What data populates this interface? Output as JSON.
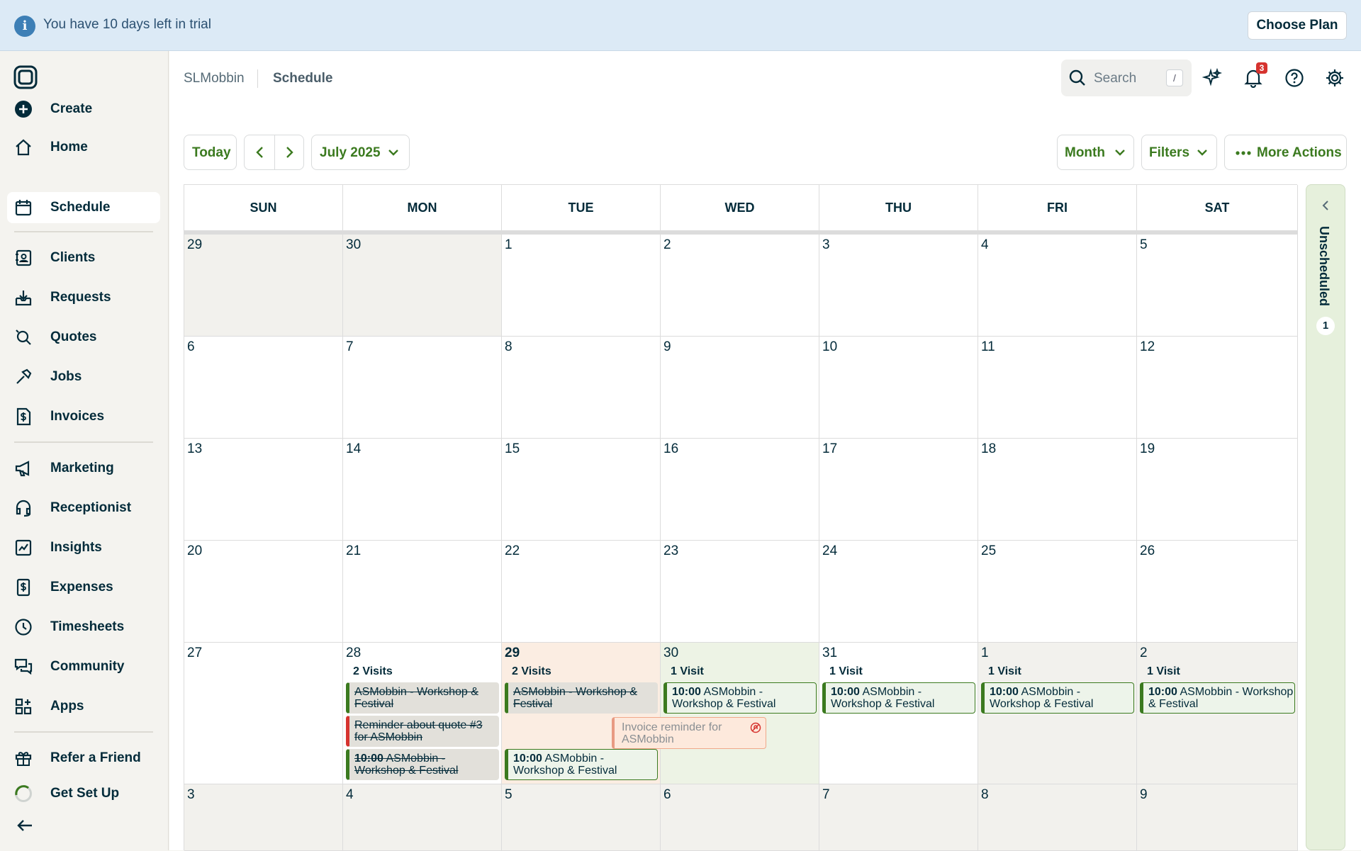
{
  "banner": {
    "message": "You have 10 days left in trial",
    "cta": "Choose Plan"
  },
  "nav": {
    "items": [
      {
        "label": "Create",
        "icon": "plus-circle-icon",
        "active": false
      },
      {
        "label": "Home",
        "icon": "home-icon",
        "active": false
      },
      {
        "label": "Schedule",
        "icon": "calendar-icon",
        "active": true
      },
      {
        "label": "Clients",
        "icon": "address-book-icon",
        "active": false
      },
      {
        "label": "Requests",
        "icon": "inbox-download-icon",
        "active": false
      },
      {
        "label": "Quotes",
        "icon": "quote-search-icon",
        "active": false
      },
      {
        "label": "Jobs",
        "icon": "hammer-icon",
        "active": false
      },
      {
        "label": "Invoices",
        "icon": "invoice-dollar-icon",
        "active": false
      },
      {
        "label": "Marketing",
        "icon": "megaphone-icon",
        "active": false
      },
      {
        "label": "Receptionist",
        "icon": "headset-icon",
        "active": false
      },
      {
        "label": "Insights",
        "icon": "chart-line-icon",
        "active": false
      },
      {
        "label": "Expenses",
        "icon": "receipt-dollar-icon",
        "active": false
      },
      {
        "label": "Timesheets",
        "icon": "clock-icon",
        "active": false
      },
      {
        "label": "Community",
        "icon": "chat-bubbles-icon",
        "active": false
      },
      {
        "label": "Apps",
        "icon": "apps-grid-icon",
        "active": false
      },
      {
        "label": "Refer a Friend",
        "icon": "gift-icon",
        "active": false
      },
      {
        "label": "Get Set Up",
        "icon": "progress-ring-icon",
        "active": false
      }
    ]
  },
  "header": {
    "account": "SLMobbin",
    "page": "Schedule",
    "search_placeholder": "Search",
    "search_shortcut": "/",
    "notifications": "3"
  },
  "toolbar": {
    "today": "Today",
    "month_label": "July 2025",
    "view": "Month",
    "filters": "Filters",
    "more": "More Actions"
  },
  "calendar": {
    "weekdays": [
      "SUN",
      "MON",
      "TUE",
      "WED",
      "THU",
      "FRI",
      "SAT"
    ],
    "weeks": [
      [
        "29",
        "30",
        "1",
        "2",
        "3",
        "4",
        "5"
      ],
      [
        "6",
        "7",
        "8",
        "9",
        "10",
        "11",
        "12"
      ],
      [
        "13",
        "14",
        "15",
        "16",
        "17",
        "18",
        "19"
      ],
      [
        "20",
        "21",
        "22",
        "23",
        "24",
        "25",
        "26"
      ],
      [
        "27",
        "28",
        "29",
        "30",
        "31",
        "1",
        "2"
      ],
      [
        "3",
        "4",
        "5",
        "6",
        "7",
        "8",
        "9"
      ]
    ],
    "visit_counts": {
      "mon": "2 Visits",
      "tue": "2 Visits",
      "wed": "1 Visit",
      "thu": "1 Visit",
      "fri": "1 Visit",
      "sat": "1 Visit"
    },
    "events": {
      "mon1": "ASMobbin - Workshop & Festival",
      "mon2": "Reminder about quote #3 for ASMobbin",
      "mon3_time": "10:00",
      "mon3_text": "ASMobbin - Workshop & Festival",
      "tue1": "ASMobbin - Workshop & Festival",
      "tue2_time": "10:00",
      "tue2_text": "ASMobbin - Workshop & Festival",
      "wed_time": "10:00",
      "wed_text": "ASMobbin - Workshop & Festival",
      "thu_time": "10:00",
      "thu_text": "ASMobbin - Workshop & Festival",
      "fri_time": "10:00",
      "fri_text": "ASMobbin - Workshop & Festival",
      "sat_time": "10:00",
      "sat_text": "ASMobbin - Workshop & Festival",
      "invoice_reminder": "Invoice reminder for ASMobbin"
    }
  },
  "unscheduled": {
    "label": "Unscheduled",
    "count": "1"
  },
  "colors": {
    "accent": "#3b7a1f",
    "navy": "#032b3a",
    "alert": "#d6332f"
  }
}
